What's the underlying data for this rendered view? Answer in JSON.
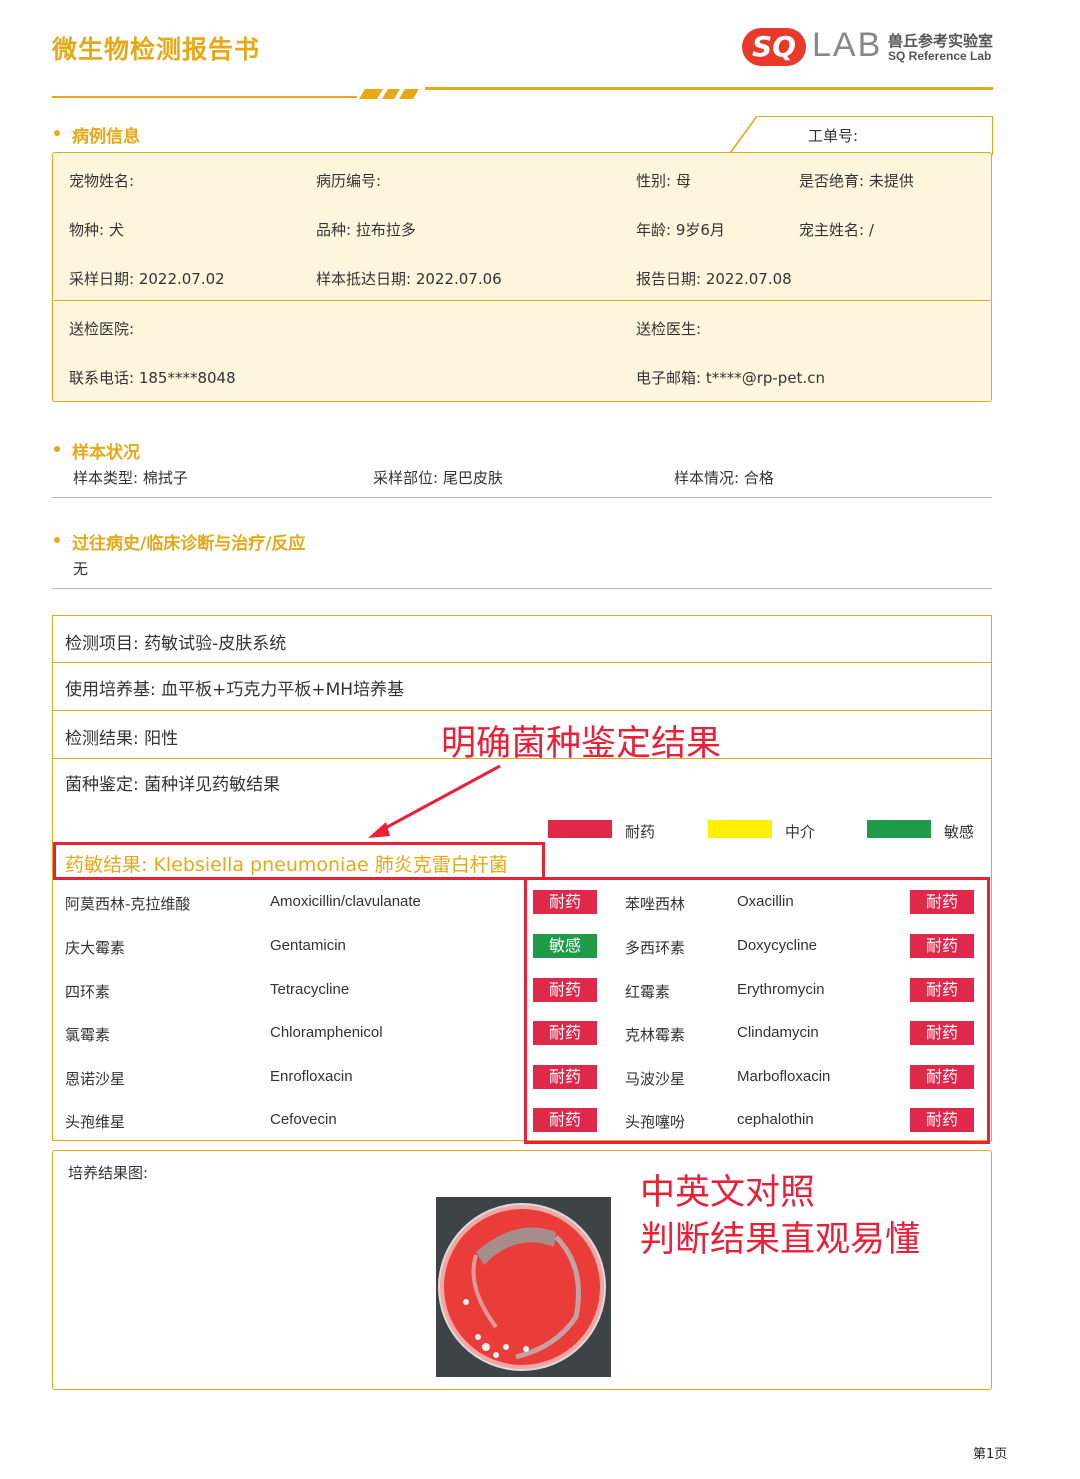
{
  "header": {
    "title": "微生物检测报告书",
    "logo": {
      "mark": "SQ",
      "lab": "LAB",
      "name_cn": "兽丘参考实验室",
      "name_en": "SQ Reference Lab"
    }
  },
  "case_info": {
    "section_title": "病例信息",
    "order_no_label": "工单号:",
    "fields": {
      "pet_name": "宠物姓名:",
      "record_no": "病历编号:",
      "sex": "性别:  母",
      "neutered": "是否绝育:  未提供",
      "species": "物种:  犬",
      "breed": "品种:  拉布拉多",
      "age": "年龄:  9岁6月",
      "owner": "宠主姓名:  /",
      "sample_date": "采样日期:  2022.07.02",
      "arrival_date": "样本抵达日期:  2022.07.06",
      "report_date": "报告日期:  2022.07.08",
      "hospital": "送检医院:",
      "doctor": "送检医生:",
      "phone": "联系电话:  185****8048",
      "email": "电子邮箱:  t****@rp-pet.cn"
    }
  },
  "sample": {
    "section_title": "样本状况",
    "type": "样本类型:  棉拭子",
    "site": "采样部位:  尾巴皮肤",
    "condition": "样本情况:  合格"
  },
  "history": {
    "section_title": "过往病史/临床诊断与治疗/反应",
    "value": "无"
  },
  "test": {
    "item": "检测项目:  药敏试验-皮肤系统",
    "medium": "使用培养基:  血平板+巧克力平板+MH培养基",
    "result": "检测结果:  阳性",
    "identification": "菌种鉴定:  菌种详见药敏结果"
  },
  "annotations": {
    "identify": "明确菌种鉴定结果",
    "compare_line1": "中英文对照",
    "compare_line2": "判断结果直观易懂"
  },
  "legend": [
    {
      "label": "耐药",
      "color": "#e0294a"
    },
    {
      "label": "中介",
      "color": "#ffef00"
    },
    {
      "label": "敏感",
      "color": "#1e9a48"
    }
  ],
  "susceptibility": {
    "title": "药敏结果:  Klebsiella pneumoniae 肺炎克雷白杆菌",
    "left": [
      {
        "cn": "阿莫西林-克拉维酸",
        "en": "Amoxicillin/clavulanate",
        "result": "耐药"
      },
      {
        "cn": "庆大霉素",
        "en": "Gentamicin",
        "result": "敏感"
      },
      {
        "cn": "四环素",
        "en": "Tetracycline",
        "result": "耐药"
      },
      {
        "cn": "氯霉素",
        "en": "Chloramphenicol",
        "result": "耐药"
      },
      {
        "cn": "恩诺沙星",
        "en": "Enrofloxacin",
        "result": "耐药"
      },
      {
        "cn": "头孢维星",
        "en": "Cefovecin",
        "result": "耐药"
      }
    ],
    "right": [
      {
        "cn": "苯唑西林",
        "en": "Oxacillin",
        "result": "耐药"
      },
      {
        "cn": "多西环素",
        "en": "Doxycycline",
        "result": "耐药"
      },
      {
        "cn": "红霉素",
        "en": "Erythromycin",
        "result": "耐药"
      },
      {
        "cn": "克林霉素",
        "en": "Clindamycin",
        "result": "耐药"
      },
      {
        "cn": "马波沙星",
        "en": "Marbofloxacin",
        "result": "耐药"
      },
      {
        "cn": "头孢噻吩",
        "en": "cephalothin",
        "result": "耐药"
      }
    ]
  },
  "culture": {
    "label": "培养结果图:"
  },
  "footer": {
    "page": "第1页"
  }
}
